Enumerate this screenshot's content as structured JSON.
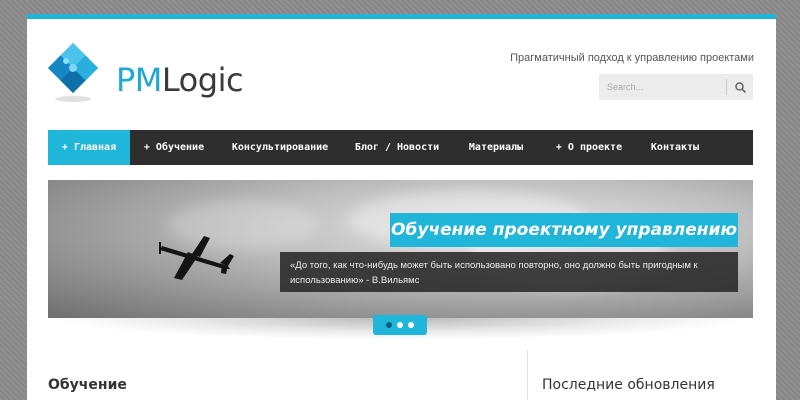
{
  "brand": {
    "logo_prefix": "PM",
    "logo_suffix": "Logic",
    "tagline": "Прагматичный подход к управлению проектами",
    "accent_color": "#1fb6d9"
  },
  "search": {
    "placeholder": "Search...",
    "icon": "search-icon"
  },
  "nav": {
    "items": [
      {
        "label": "+ Главная",
        "active": true
      },
      {
        "label": "+ Обучение",
        "active": false
      },
      {
        "label": "Консультирование",
        "active": false
      },
      {
        "label": "Блог / Новости",
        "active": false
      },
      {
        "label": "Материалы",
        "active": false
      },
      {
        "label": "+ О проекте",
        "active": false
      },
      {
        "label": "Контакты",
        "active": false
      }
    ]
  },
  "slider": {
    "title": "Обучение проектному управлению",
    "quote": "«До того, как что-нибудь может быть использовано повторно, оно должно быть пригодным к использованию» - В.Вильямс",
    "dots_count": 3,
    "active_dot": 0
  },
  "sections": {
    "left_heading": "Обучение",
    "right_heading": "Последние обновления"
  }
}
